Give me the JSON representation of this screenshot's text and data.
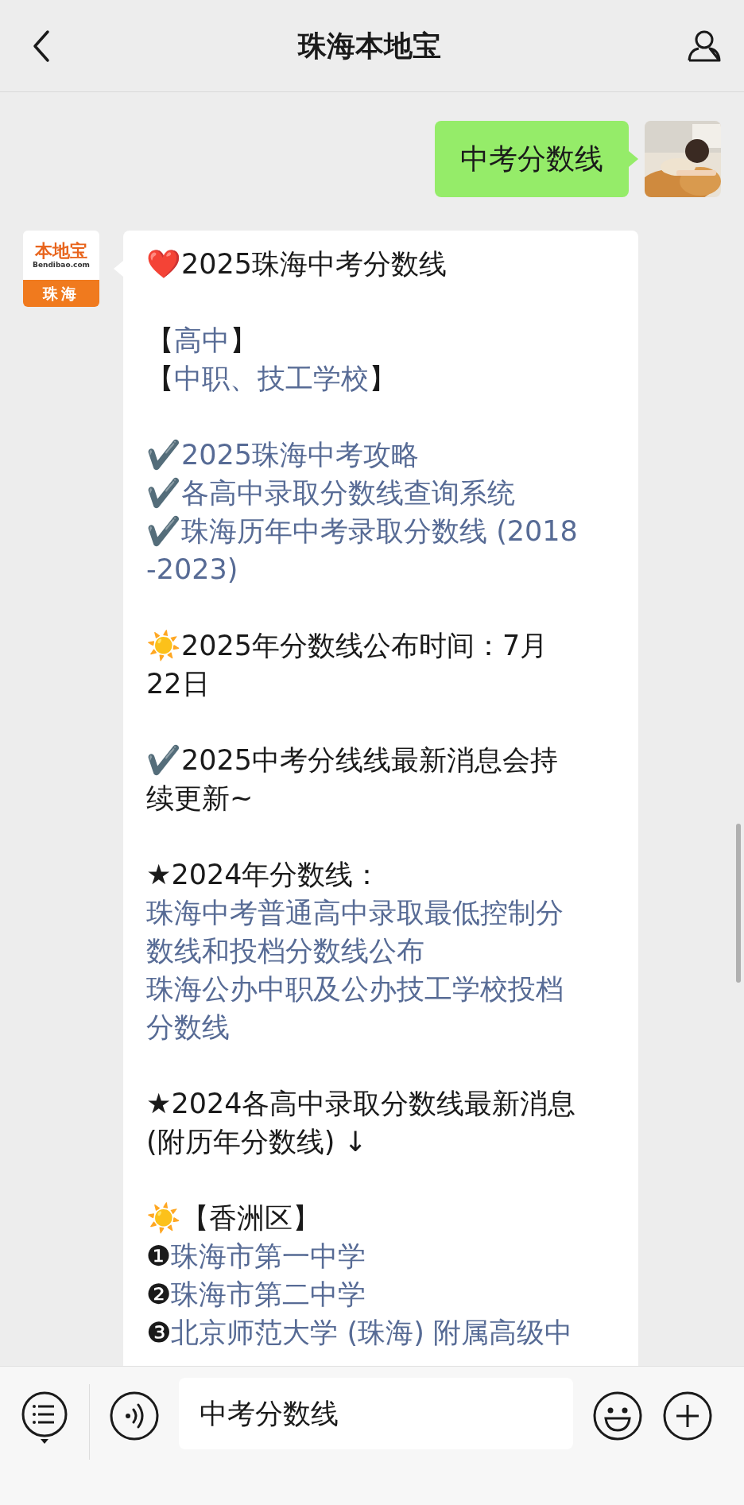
{
  "header": {
    "title": "珠海本地宝"
  },
  "sent": {
    "text": "中考分数线"
  },
  "logo": {
    "brand": "本地宝",
    "site": "Bendibao.com",
    "city": "珠海"
  },
  "received": {
    "blocks": [
      {
        "lines": [
          [
            {
              "kind": "mark",
              "text": "❤️"
            },
            {
              "kind": "text",
              "text": "2025珠海中考分数线"
            }
          ]
        ]
      },
      {
        "lines": [
          [
            {
              "kind": "text",
              "text": "【"
            },
            {
              "kind": "link",
              "text": "高中"
            },
            {
              "kind": "text",
              "text": "】"
            }
          ],
          [
            {
              "kind": "text",
              "text": "【"
            },
            {
              "kind": "link",
              "text": "中职、技工学校"
            },
            {
              "kind": "text",
              "text": "】"
            }
          ]
        ]
      },
      {
        "lines": [
          [
            {
              "kind": "mark",
              "text": "✔️"
            },
            {
              "kind": "link",
              "text": "2025珠海中考攻略"
            }
          ],
          [
            {
              "kind": "mark",
              "text": "✔️"
            },
            {
              "kind": "link",
              "text": "各高中录取分数线查询系统"
            }
          ],
          [
            {
              "kind": "mark",
              "text": "✔️"
            },
            {
              "kind": "link",
              "text": "珠海历年中考录取分数线 (2018"
            }
          ],
          [
            {
              "kind": "link",
              "text": "-2023)"
            }
          ]
        ]
      },
      {
        "lines": [
          [
            {
              "kind": "mark",
              "text": "☀️"
            },
            {
              "kind": "text",
              "text": "2025年分数线公布时间：7月"
            }
          ],
          [
            {
              "kind": "text",
              "text": "22日"
            }
          ]
        ]
      },
      {
        "lines": [
          [
            {
              "kind": "mark",
              "text": "✔️"
            },
            {
              "kind": "text",
              "text": "2025中考分线线最新消息会持"
            }
          ],
          [
            {
              "kind": "text",
              "text": "续更新~"
            }
          ]
        ]
      },
      {
        "lines": [
          [
            {
              "kind": "text",
              "text": "★2024年分数线："
            }
          ],
          [
            {
              "kind": "link",
              "text": "珠海中考普通高中录取最低控制分"
            }
          ],
          [
            {
              "kind": "link",
              "text": "数线和投档分数线公布"
            }
          ],
          [
            {
              "kind": "link",
              "text": "珠海公办中职及公办技工学校投档"
            }
          ],
          [
            {
              "kind": "link",
              "text": "分数线"
            }
          ]
        ]
      },
      {
        "lines": [
          [
            {
              "kind": "text",
              "text": "★2024各高中录取分数线最新消息"
            }
          ],
          [
            {
              "kind": "text",
              "text": "(附历年分数线) ↓"
            }
          ]
        ]
      },
      {
        "lines": [
          [
            {
              "kind": "mark",
              "text": "☀️"
            },
            {
              "kind": "text",
              "text": "【香洲区】"
            }
          ],
          [
            {
              "kind": "number",
              "text": "❶"
            },
            {
              "kind": "link",
              "text": "珠海市第一中学"
            }
          ],
          [
            {
              "kind": "number",
              "text": "❷"
            },
            {
              "kind": "link",
              "text": "珠海市第二中学"
            }
          ],
          [
            {
              "kind": "number",
              "text": "❸"
            },
            {
              "kind": "link",
              "text": "北京师范大学 (珠海) 附属高级中"
            }
          ]
        ]
      }
    ]
  },
  "input": {
    "value": "中考分数线"
  }
}
